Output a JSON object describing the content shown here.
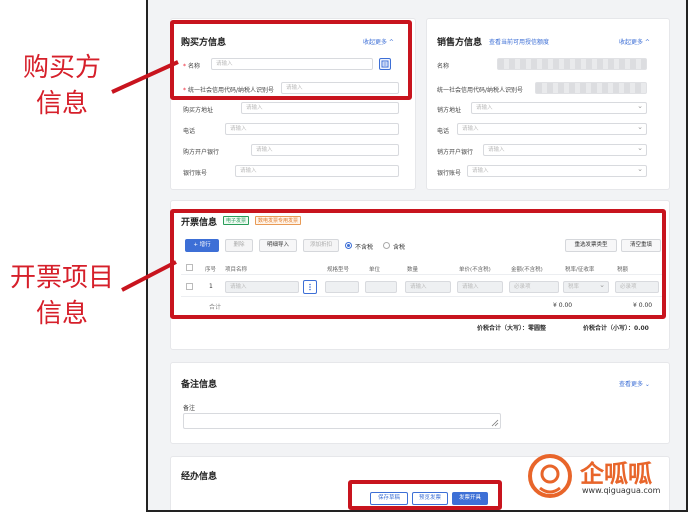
{
  "annotations": {
    "buyer_line1": "购买方",
    "buyer_line2": "信息",
    "items_line1": "开票项目",
    "items_line2": "信息"
  },
  "buyer": {
    "title": "购买方信息",
    "collapse": "收起更多 ^",
    "name_label": "名称",
    "name_placeholder": "请输入",
    "tax_label": "统一社会信用代码/纳税人识别号",
    "tax_placeholder": "请输入",
    "address_label": "购买方地址",
    "address_placeholder": "请输入",
    "phone_label": "电话",
    "phone_placeholder": "请输入",
    "bank_label": "购方开户银行",
    "bank_placeholder": "请输入",
    "account_label": "银行账号",
    "account_placeholder": "请输入"
  },
  "seller": {
    "title": "销售方信息",
    "link": "查看当前可用授信额度",
    "collapse": "收起更多 ^",
    "name_label": "名称",
    "tax_label": "统一社会信用代码/纳税人识别号",
    "address_label": "销方地址",
    "address_placeholder": "请输入",
    "phone_label": "电话",
    "phone_placeholder": "请输入",
    "bank_label": "销方开户银行",
    "bank_placeholder": "请输入",
    "account_label": "银行账号",
    "account_placeholder": "请输入"
  },
  "invoice": {
    "title": "开票信息",
    "tag1": "电子发票",
    "tag2": "数电发票专用发票",
    "btn_add": "+ 增行",
    "btn_delete": "删除",
    "btn_import": "明细导入",
    "btn_discount": "添加折扣",
    "radio_excl": "不含税",
    "radio_incl": "含税",
    "btn_reselect": "重选发票类型",
    "btn_clear": "清空重填",
    "headers": [
      "序号",
      "项目名称",
      "规格型号",
      "单位",
      "数量",
      "单价(不含税)",
      "金额(不含税)",
      "税率/征收率",
      "税额"
    ],
    "row_index": "1",
    "row_name_placeholder": "请输入",
    "row_qty_placeholder": "请输入",
    "row_price_placeholder": "请输入",
    "row_amount_placeholder": "必录项",
    "row_rate_placeholder": "税率",
    "row_tax_placeholder": "必录项",
    "sum_label": "合计",
    "sum_amount": "¥ 0.00",
    "sum_tax": "¥ 0.00",
    "total_upper_label": "价税合计（大写）：",
    "total_upper_value": "零圆整",
    "total_lower_label": "价税合计（小写）：",
    "total_lower_value": "0.00"
  },
  "remark": {
    "title": "备注信息",
    "link": "查看更多 ⌄",
    "label": "备注"
  },
  "handler": {
    "title": "经办信息"
  },
  "footer": {
    "btn_save": "保存草稿",
    "btn_preview": "预览发票",
    "btn_issue": "发票开具"
  },
  "watermark": {
    "brand": "企呱呱",
    "url": "www.qiguagua.com"
  }
}
